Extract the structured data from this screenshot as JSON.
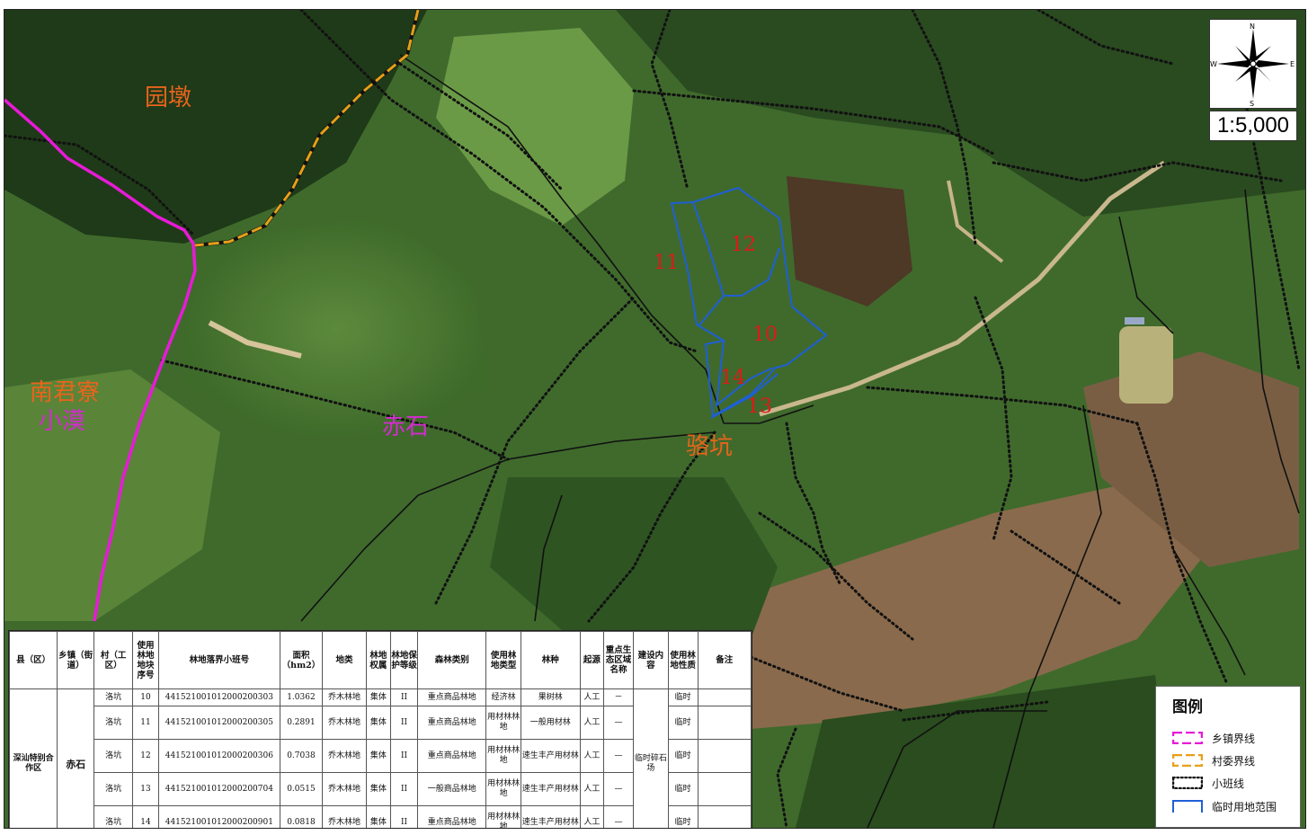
{
  "map": {
    "place_labels": {
      "yuandun": "园墩",
      "nanjunliao": "南君寮",
      "xiaomo": "小漠",
      "chishi": "赤石",
      "luokeng": "骆坑"
    },
    "plot_labels": [
      "10",
      "11",
      "12",
      "13",
      "14"
    ],
    "scale": "1:5,000",
    "compass": {
      "n": "N",
      "s": "S",
      "e": "E",
      "w": "W"
    },
    "colors": {
      "town_boundary": "#e81ad8",
      "village_boundary": "#e6a019",
      "subcompartment_line": "#111111",
      "temporary_use_boundary": "#1f5fd6",
      "place_label": "#e8641c",
      "town_label": "#d42bd0",
      "plot_label": "#e01818"
    }
  },
  "legend": {
    "title": "图例",
    "items": [
      {
        "label": "乡镇界线",
        "icon": "town-boundary-swatch",
        "color": "#e81ad8"
      },
      {
        "label": "村委界线",
        "icon": "village-boundary-swatch",
        "color": "#e6a019"
      },
      {
        "label": "小班线",
        "icon": "subcompartment-line-swatch",
        "color": "#111111"
      },
      {
        "label": "临时用地范围",
        "icon": "temporary-use-swatch",
        "color": "#1f5fd6"
      }
    ]
  },
  "table": {
    "headers": [
      "县（区）",
      "乡镇（街道）",
      "村（工区）",
      "使用林地地块序号",
      "林地落界小班号",
      "面积（hm2）",
      "地类",
      "林地权属",
      "林地保护等级",
      "森林类别",
      "使用林地类型",
      "林种",
      "起源",
      "重点生态区域名称",
      "建设内容",
      "使用林地性质",
      "备注"
    ],
    "county": "深汕特别合作区",
    "town": "赤石",
    "construction": "临时碎石场",
    "rows": [
      {
        "village": "洛坑",
        "seq": "10",
        "code": "441521001012000200303",
        "area": "1.0362",
        "land": "乔木林地",
        "owner": "集体",
        "level": "II",
        "category": "重点商品林地",
        "type": "经济林",
        "species": "果树林",
        "origin": "人工",
        "eco": "－",
        "nature": "临时",
        "note": ""
      },
      {
        "village": "洛坑",
        "seq": "11",
        "code": "441521001012000200305",
        "area": "0.2891",
        "land": "乔木林地",
        "owner": "集体",
        "level": "II",
        "category": "重点商品林地",
        "type": "用材林林地",
        "species": "一般用材林",
        "origin": "人工",
        "eco": "—",
        "nature": "临时",
        "note": ""
      },
      {
        "village": "洛坑",
        "seq": "12",
        "code": "441521001012000200306",
        "area": "0.7038",
        "land": "乔木林地",
        "owner": "集体",
        "level": "II",
        "category": "重点商品林地",
        "type": "用材林林地",
        "species": "速生丰产用材林",
        "origin": "人工",
        "eco": "—",
        "nature": "临时",
        "note": ""
      },
      {
        "village": "洛坑",
        "seq": "13",
        "code": "441521001012000200704",
        "area": "0.0515",
        "land": "乔木林地",
        "owner": "集体",
        "level": "II",
        "category": "一般商品林地",
        "type": "用材林林地",
        "species": "速生丰产用材林",
        "origin": "人工",
        "eco": "—",
        "nature": "临时",
        "note": ""
      },
      {
        "village": "洛坑",
        "seq": "14",
        "code": "441521001012000200901",
        "area": "0.0818",
        "land": "乔木林地",
        "owner": "集体",
        "level": "II",
        "category": "重点商品林地",
        "type": "用材林林地",
        "species": "速生丰产用材林",
        "origin": "人工",
        "eco": "—",
        "nature": "临时",
        "note": ""
      }
    ]
  }
}
